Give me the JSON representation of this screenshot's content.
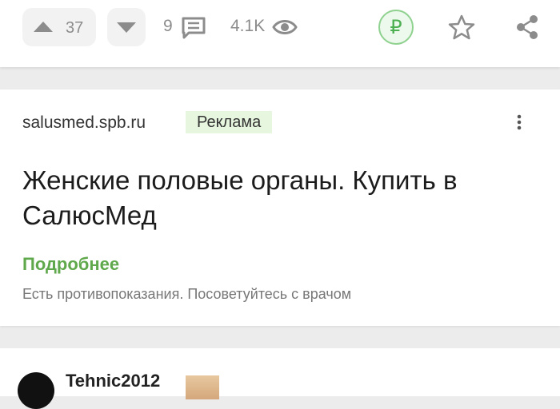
{
  "toolbar": {
    "upvote_count": "37",
    "comment_count": "9",
    "views_count": "4.1K",
    "donate_symbol": "₽",
    "icons": {
      "upvote": "arrow-up-icon",
      "downvote": "arrow-down-icon",
      "comments": "comment-icon",
      "views": "eye-icon",
      "donate": "ruble-icon",
      "favorite": "star-icon",
      "share": "share-icon"
    }
  },
  "ad": {
    "domain": "salusmed.spb.ru",
    "badge": "Реклама",
    "title": "Женские половые органы. Купить в СалюсМед",
    "more_link": "Подробнее",
    "disclaimer": "Есть противопоказания. Посоветуйтесь с врачом"
  },
  "next_post": {
    "author": "Tehnic2012"
  },
  "colors": {
    "accent_green": "#5fa84b",
    "badge_bg": "#e7f7df",
    "icon_gray": "#8c8c8c"
  }
}
